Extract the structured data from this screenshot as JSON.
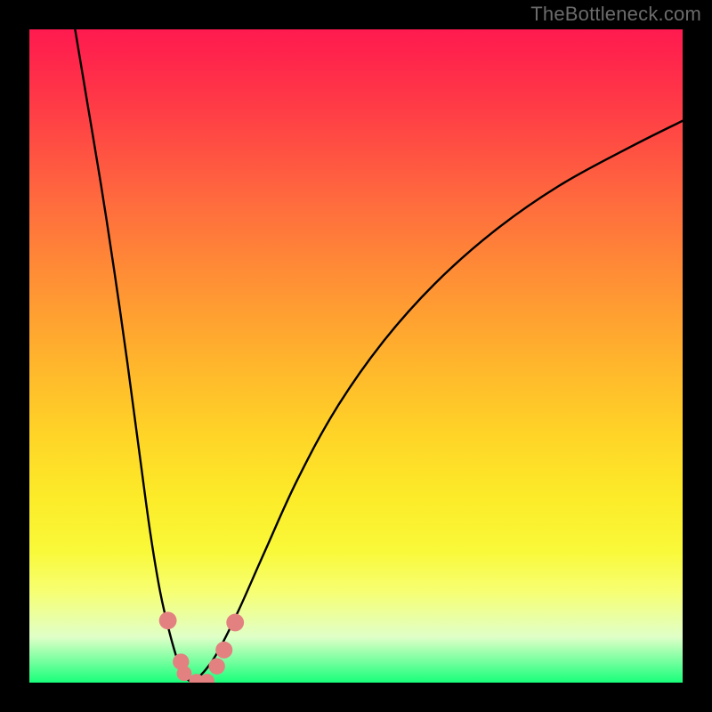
{
  "watermark": "TheBottleneck.com",
  "chart_data": {
    "type": "line",
    "title": "",
    "xlabel": "",
    "ylabel": "",
    "xlim": [
      0,
      100
    ],
    "ylim": [
      0,
      100
    ],
    "grid": false,
    "legend": false,
    "series": [
      {
        "name": "left-branch",
        "x": [
          7,
          9,
          11,
          13,
          15,
          17,
          18.5,
          20,
          21.5,
          23,
          24,
          25
        ],
        "y": [
          100,
          88,
          76,
          63,
          49,
          34,
          23,
          14,
          7.5,
          2.5,
          0.7,
          0
        ]
      },
      {
        "name": "right-branch",
        "x": [
          25,
          27,
          29,
          32,
          36,
          41,
          47,
          54,
          62,
          71,
          81,
          92,
          100
        ],
        "y": [
          0,
          2,
          5,
          11,
          20,
          31,
          42,
          52,
          61,
          69,
          76,
          82,
          86
        ]
      }
    ],
    "markers": [
      {
        "name": "left-dot-1",
        "x": 21.2,
        "y": 9.5,
        "r": 1.35
      },
      {
        "name": "left-dot-2",
        "x": 23.2,
        "y": 3.2,
        "r": 1.25
      },
      {
        "name": "left-dot-3",
        "x": 23.7,
        "y": 1.4,
        "r": 1.15
      },
      {
        "name": "bottom-dot-1",
        "x": 25.6,
        "y": 0.2,
        "r": 1.15
      },
      {
        "name": "bottom-dot-2",
        "x": 27.2,
        "y": 0.2,
        "r": 1.15
      },
      {
        "name": "right-dot-1",
        "x": 28.7,
        "y": 2.5,
        "r": 1.25
      },
      {
        "name": "right-dot-2",
        "x": 29.8,
        "y": 5.0,
        "r": 1.3
      },
      {
        "name": "right-dot-3",
        "x": 31.5,
        "y": 9.2,
        "r": 1.35
      }
    ],
    "marker_color": "#e38181",
    "curve_color": "#000000",
    "gradient": {
      "stops": [
        {
          "pos": 0,
          "color": "#ff1a4f"
        },
        {
          "pos": 26,
          "color": "#ff6a3e"
        },
        {
          "pos": 50,
          "color": "#ffb22d"
        },
        {
          "pos": 72,
          "color": "#fcec29"
        },
        {
          "pos": 86,
          "color": "#f7ff72"
        },
        {
          "pos": 100,
          "color": "#18ff7a"
        }
      ]
    }
  }
}
